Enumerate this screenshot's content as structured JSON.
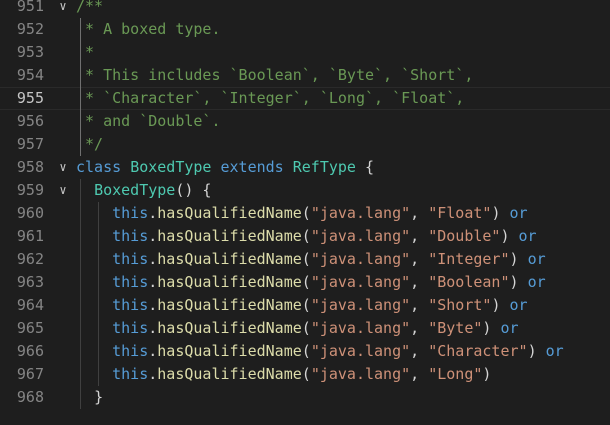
{
  "editor": {
    "lines": [
      {
        "num": "951",
        "fold": "∨",
        "text": "/**",
        "kind": "comment"
      },
      {
        "num": "952",
        "text": " * A boxed type.",
        "kind": "comment"
      },
      {
        "num": "953",
        "text": " *",
        "kind": "comment"
      },
      {
        "num": "954",
        "text": " * This includes `Boolean`, `Byte`, `Short`,",
        "kind": "comment"
      },
      {
        "num": "955",
        "text": " * `Character`, `Integer`, `Long`, `Float`,",
        "kind": "comment",
        "active": true
      },
      {
        "num": "956",
        "text": " * and `Double`.",
        "kind": "comment"
      },
      {
        "num": "957",
        "text": " */",
        "kind": "comment"
      },
      {
        "num": "958",
        "fold": "∨",
        "kind": "class_decl",
        "kw": "class",
        "name": "BoxedType",
        "extends_kw": "extends",
        "super": "RefType",
        "brace": " {"
      },
      {
        "num": "959",
        "fold": "∨",
        "kind": "ctor",
        "name": "BoxedType",
        "rest": "() {"
      },
      {
        "num": "960",
        "kind": "call",
        "this": "this",
        "method": "hasQualifiedName",
        "arg1": "\"java.lang\"",
        "arg2": "\"Float\"",
        "tail": "or"
      },
      {
        "num": "961",
        "kind": "call",
        "this": "this",
        "method": "hasQualifiedName",
        "arg1": "\"java.lang\"",
        "arg2": "\"Double\"",
        "tail": "or"
      },
      {
        "num": "962",
        "kind": "call",
        "this": "this",
        "method": "hasQualifiedName",
        "arg1": "\"java.lang\"",
        "arg2": "\"Integer\"",
        "tail": "or"
      },
      {
        "num": "963",
        "kind": "call",
        "this": "this",
        "method": "hasQualifiedName",
        "arg1": "\"java.lang\"",
        "arg2": "\"Boolean\"",
        "tail": "or"
      },
      {
        "num": "964",
        "kind": "call",
        "this": "this",
        "method": "hasQualifiedName",
        "arg1": "\"java.lang\"",
        "arg2": "\"Short\"",
        "tail": "or"
      },
      {
        "num": "965",
        "kind": "call",
        "this": "this",
        "method": "hasQualifiedName",
        "arg1": "\"java.lang\"",
        "arg2": "\"Byte\"",
        "tail": "or"
      },
      {
        "num": "966",
        "kind": "call",
        "this": "this",
        "method": "hasQualifiedName",
        "arg1": "\"java.lang\"",
        "arg2": "\"Character\"",
        "tail": "or"
      },
      {
        "num": "967",
        "kind": "call",
        "this": "this",
        "method": "hasQualifiedName",
        "arg1": "\"java.lang\"",
        "arg2": "\"Long\"",
        "tail": ""
      },
      {
        "num": "968",
        "kind": "close",
        "text": "}"
      }
    ]
  },
  "colors": {
    "background": "#1e1e1e",
    "line_number": "#858585",
    "comment": "#6a9955",
    "keyword": "#569cd6",
    "type": "#4ec9b0",
    "string": "#ce9178",
    "function": "#dcdcaa",
    "text": "#d4d4d4"
  }
}
